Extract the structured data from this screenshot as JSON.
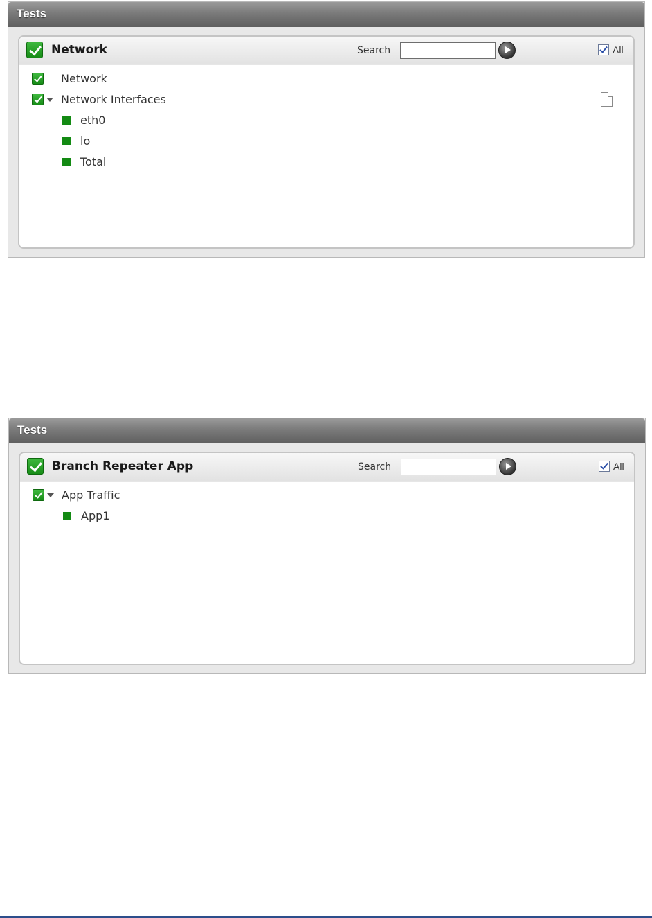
{
  "windows": [
    {
      "title": "Tests",
      "panel_title": "Network",
      "search_label": "Search",
      "search_value": "",
      "all_label": "All",
      "all_checked": true,
      "tree": [
        {
          "label": "Network",
          "type": "checkbox",
          "checked": true
        },
        {
          "label": "Network Interfaces",
          "type": "checkbox-expanded",
          "checked": true,
          "icon": "document-icon"
        },
        {
          "label": "eth0",
          "type": "status-square",
          "color": "#138a13"
        },
        {
          "label": "lo",
          "type": "status-square",
          "color": "#138a13"
        },
        {
          "label": "Total",
          "type": "status-square",
          "color": "#138a13"
        }
      ]
    },
    {
      "title": "Tests",
      "panel_title": "Branch Repeater App",
      "search_label": "Search",
      "search_value": "",
      "all_label": "All",
      "all_checked": true,
      "tree": [
        {
          "label": "App Traffic",
          "type": "checkbox-expanded",
          "checked": true
        },
        {
          "label": "App1",
          "type": "status-square",
          "color": "#138a13"
        }
      ]
    }
  ],
  "colors": {
    "status_green": "#138a13",
    "title_bar": "#7a7a7a",
    "footer_rule": "#2d4e8b"
  }
}
